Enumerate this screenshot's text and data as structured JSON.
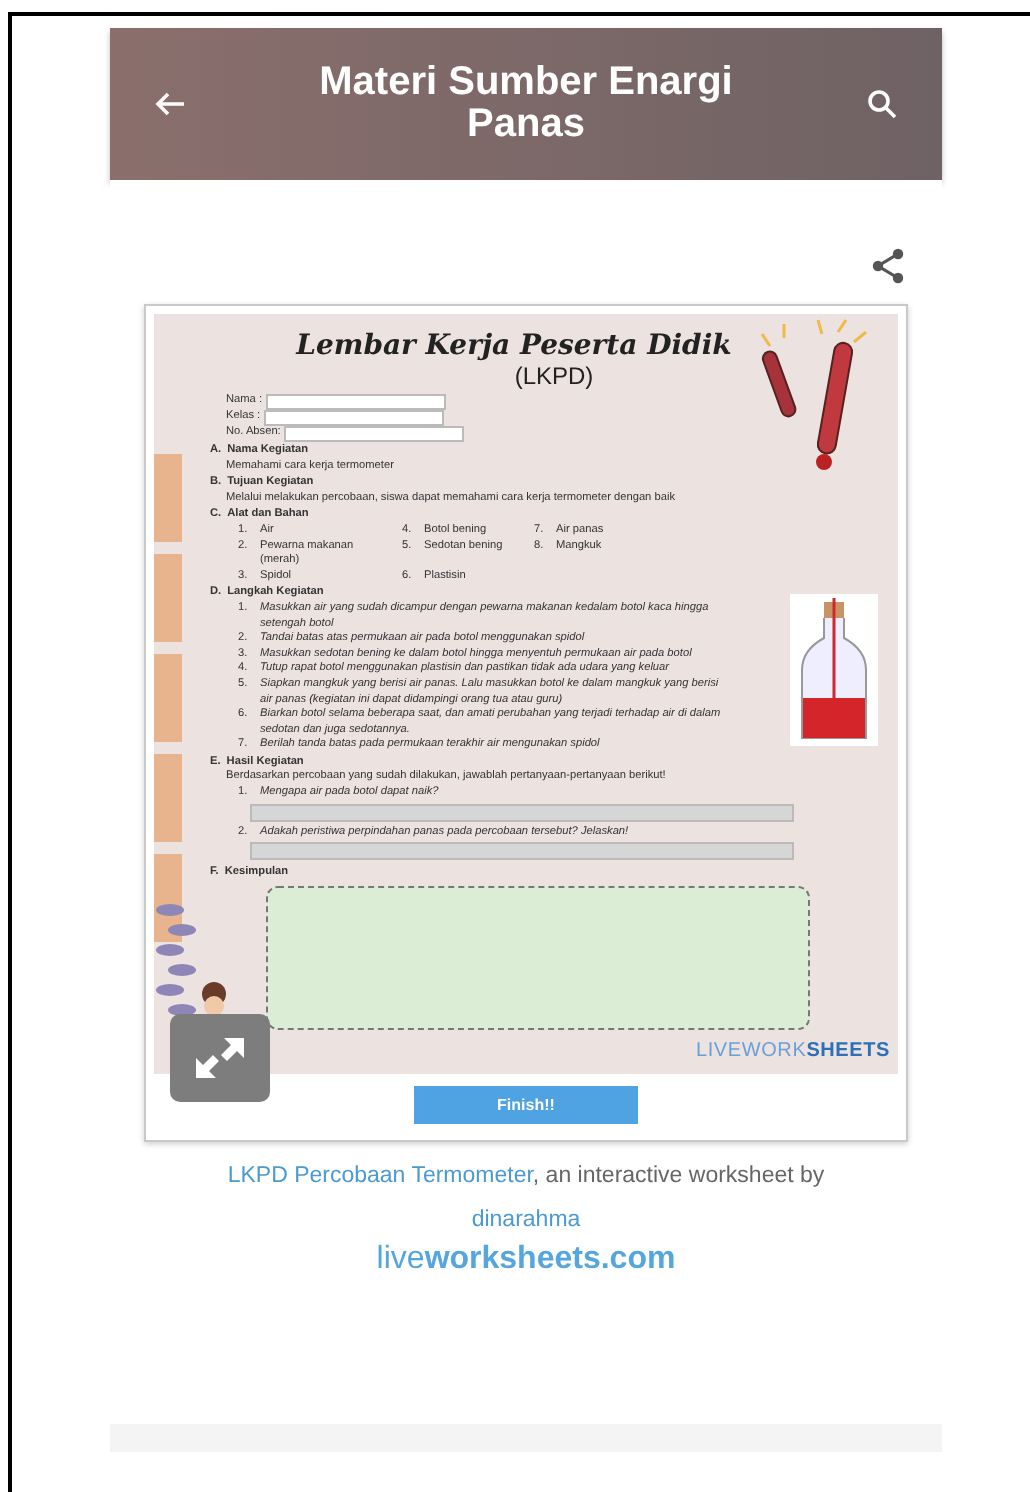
{
  "app_bar": {
    "title": "Materi Sumber Enargi Panas"
  },
  "worksheet": {
    "title": "Lembar Kerja Peserta Didik",
    "subtitle": "(LKPD)",
    "identity_fields": [
      {
        "label": "Nama :"
      },
      {
        "label": "Kelas :"
      },
      {
        "label": "No. Absen:"
      }
    ],
    "sections": [
      {
        "kind": "text",
        "letter": "A.",
        "heading": "Nama Kegiatan",
        "body": "Memahami cara kerja termometer"
      },
      {
        "kind": "text",
        "letter": "B.",
        "heading": "Tujuan Kegiatan",
        "body": "Melalui melakukan percobaan, siswa dapat memahami cara kerja termometer dengan baik"
      },
      {
        "kind": "materials",
        "letter": "C.",
        "heading": "Alat dan Bahan",
        "items": [
          {
            "number": "1.",
            "text": "Air"
          },
          {
            "number": "2.",
            "text": "Pewarna makanan (merah)"
          },
          {
            "number": "3.",
            "text": "Spidol"
          },
          {
            "number": "4.",
            "text": "Botol bening"
          },
          {
            "number": "5.",
            "text": "Sedotan bening"
          },
          {
            "number": "6.",
            "text": "Plastisin"
          },
          {
            "number": "7.",
            "text": "Air panas"
          },
          {
            "number": "8.",
            "text": "Mangkuk"
          }
        ]
      },
      {
        "kind": "steps",
        "letter": "D.",
        "heading": "Langkah Kegiatan",
        "items": [
          {
            "number": "1.",
            "text": "Masukkan air yang sudah dicampur dengan pewarna makanan kedalam botol kaca hingga setengah botol"
          },
          {
            "number": "2.",
            "text": "Tandai batas atas permukaan air pada botol menggunakan spidol"
          },
          {
            "number": "3.",
            "text": "Masukkan sedotan bening ke dalam botol hingga menyentuh permukaan air pada botol"
          },
          {
            "number": "4.",
            "text": "Tutup rapat botol menggunakan plastisin dan pastikan tidak ada udara yang keluar"
          },
          {
            "number": "5.",
            "text": "Siapkan mangkuk yang berisi air panas. Lalu masukkan botol ke dalam mangkuk yang berisi air panas (kegiatan ini dapat didampingi orang tua atau guru)"
          },
          {
            "number": "6.",
            "text": "Biarkan botol selama beberapa saat, dan amati perubahan yang terjadi terhadap air di dalam sedotan dan juga sedotannya."
          },
          {
            "number": "7.",
            "text": "Berilah tanda batas pada permukaan terakhir air mengunakan spidol"
          }
        ]
      },
      {
        "kind": "questions",
        "letter": "E.",
        "heading": "Hasil Kegiatan",
        "body": "Berdasarkan percobaan yang sudah dilakukan, jawablah pertanyaan-pertanyaan berikut!",
        "items": [
          {
            "number": "1.",
            "text": "Mengapa air pada botol dapat naik?"
          },
          {
            "number": "2.",
            "text": "Adakah peristiwa perpindahan panas pada percobaan tersebut? Jelaskan!"
          }
        ]
      },
      {
        "kind": "conclusion",
        "letter": "F.",
        "heading": "Kesimpulan"
      }
    ],
    "brand": "LIVEWORK**SHEETS**"
  },
  "finish_button": "Finish!!",
  "credit": {
    "title_link": "LKPD Percobaan Termometer",
    "text": ", an interactive worksheet by",
    "author_link": "dinarahma",
    "site": "live**worksheets.com**"
  }
}
